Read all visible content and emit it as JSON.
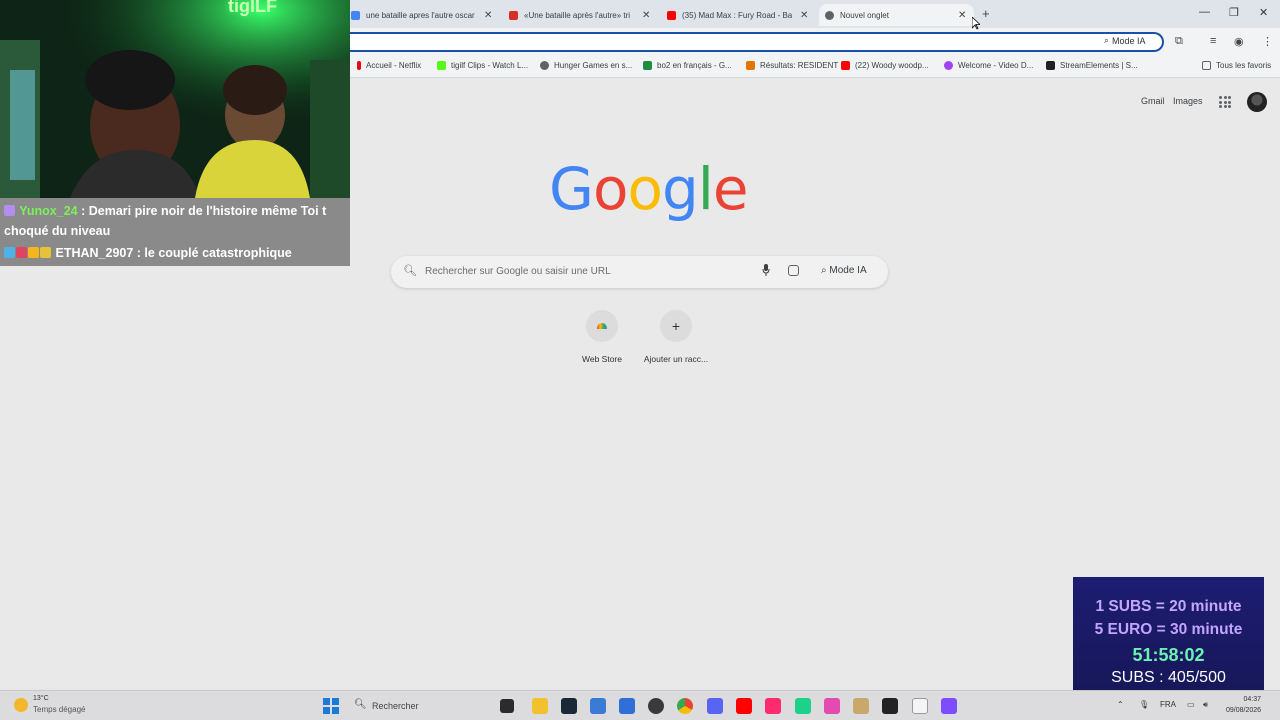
{
  "tabs": [
    {
      "title": "une bataille apres l'autre oscar",
      "icon": "google-icon",
      "color": "#4285f4"
    },
    {
      "title": "«Une bataille après l'autre» tri",
      "icon": "news-icon",
      "color": "#d93025"
    },
    {
      "title": "(35) Mad Max : Fury Road - Ba",
      "icon": "youtube-icon",
      "color": "#ff0000"
    },
    {
      "title": "Nouvel onglet",
      "icon": "chrome-icon",
      "color": "#5f6368"
    }
  ],
  "omnibox": {
    "mode_label": "Mode IA"
  },
  "bookmarks": [
    {
      "label": "Accueil - Netflix",
      "color": "#e50914"
    },
    {
      "label": "tigilf Clips - Watch L...",
      "color": "#53fc18"
    },
    {
      "label": "Hunger Games en s...",
      "color": "#5f6368"
    },
    {
      "label": "bo2 en français - G...",
      "color": "#1e8e3e"
    },
    {
      "label": "Résultats: RESIDENT",
      "color": "#e37400"
    },
    {
      "label": "(22) Woody woodp...",
      "color": "#ff0000"
    },
    {
      "label": "Welcome - Video D...",
      "color": "#a142f4"
    },
    {
      "label": "StreamElements | S...",
      "color": "#202124"
    }
  ],
  "all_bookmarks_label": "Tous les favoris",
  "google": {
    "gmail": "Gmail",
    "images": "Images",
    "search_placeholder": "Rechercher sur Google ou saisir une URL",
    "mode_ia": "Mode IA",
    "logo": [
      {
        "ch": "G",
        "color": "#4285f4"
      },
      {
        "ch": "o",
        "color": "#ea4335"
      },
      {
        "ch": "o",
        "color": "#fbbc05"
      },
      {
        "ch": "g",
        "color": "#4285f4"
      },
      {
        "ch": "l",
        "color": "#34a853"
      },
      {
        "ch": "e",
        "color": "#ea4335"
      }
    ],
    "shortcuts": [
      {
        "label": "Web Store"
      },
      {
        "label": "Ajouter un racc...",
        "glyph": "+"
      }
    ]
  },
  "chat": [
    {
      "user": "Yunox_24",
      "message": " : Demari pire noir de l'histoire même Toi t choqué du niveau"
    },
    {
      "user": "ETHAN_2907",
      "message": " : le couplé catastrophique"
    }
  ],
  "overlay_logo": "tigILF",
  "subathon": {
    "line1": "1 SUBS = 20 minute",
    "line2": "5 EURO = 30 minute",
    "timer": "51:58:02",
    "subs": "SUBS : 405/500"
  },
  "taskbar": {
    "temperature": "13°C",
    "weather": "Temps dégagé",
    "search_placeholder": "Rechercher",
    "language": "FRA",
    "time": "04:37",
    "date": "09/08/2026"
  }
}
